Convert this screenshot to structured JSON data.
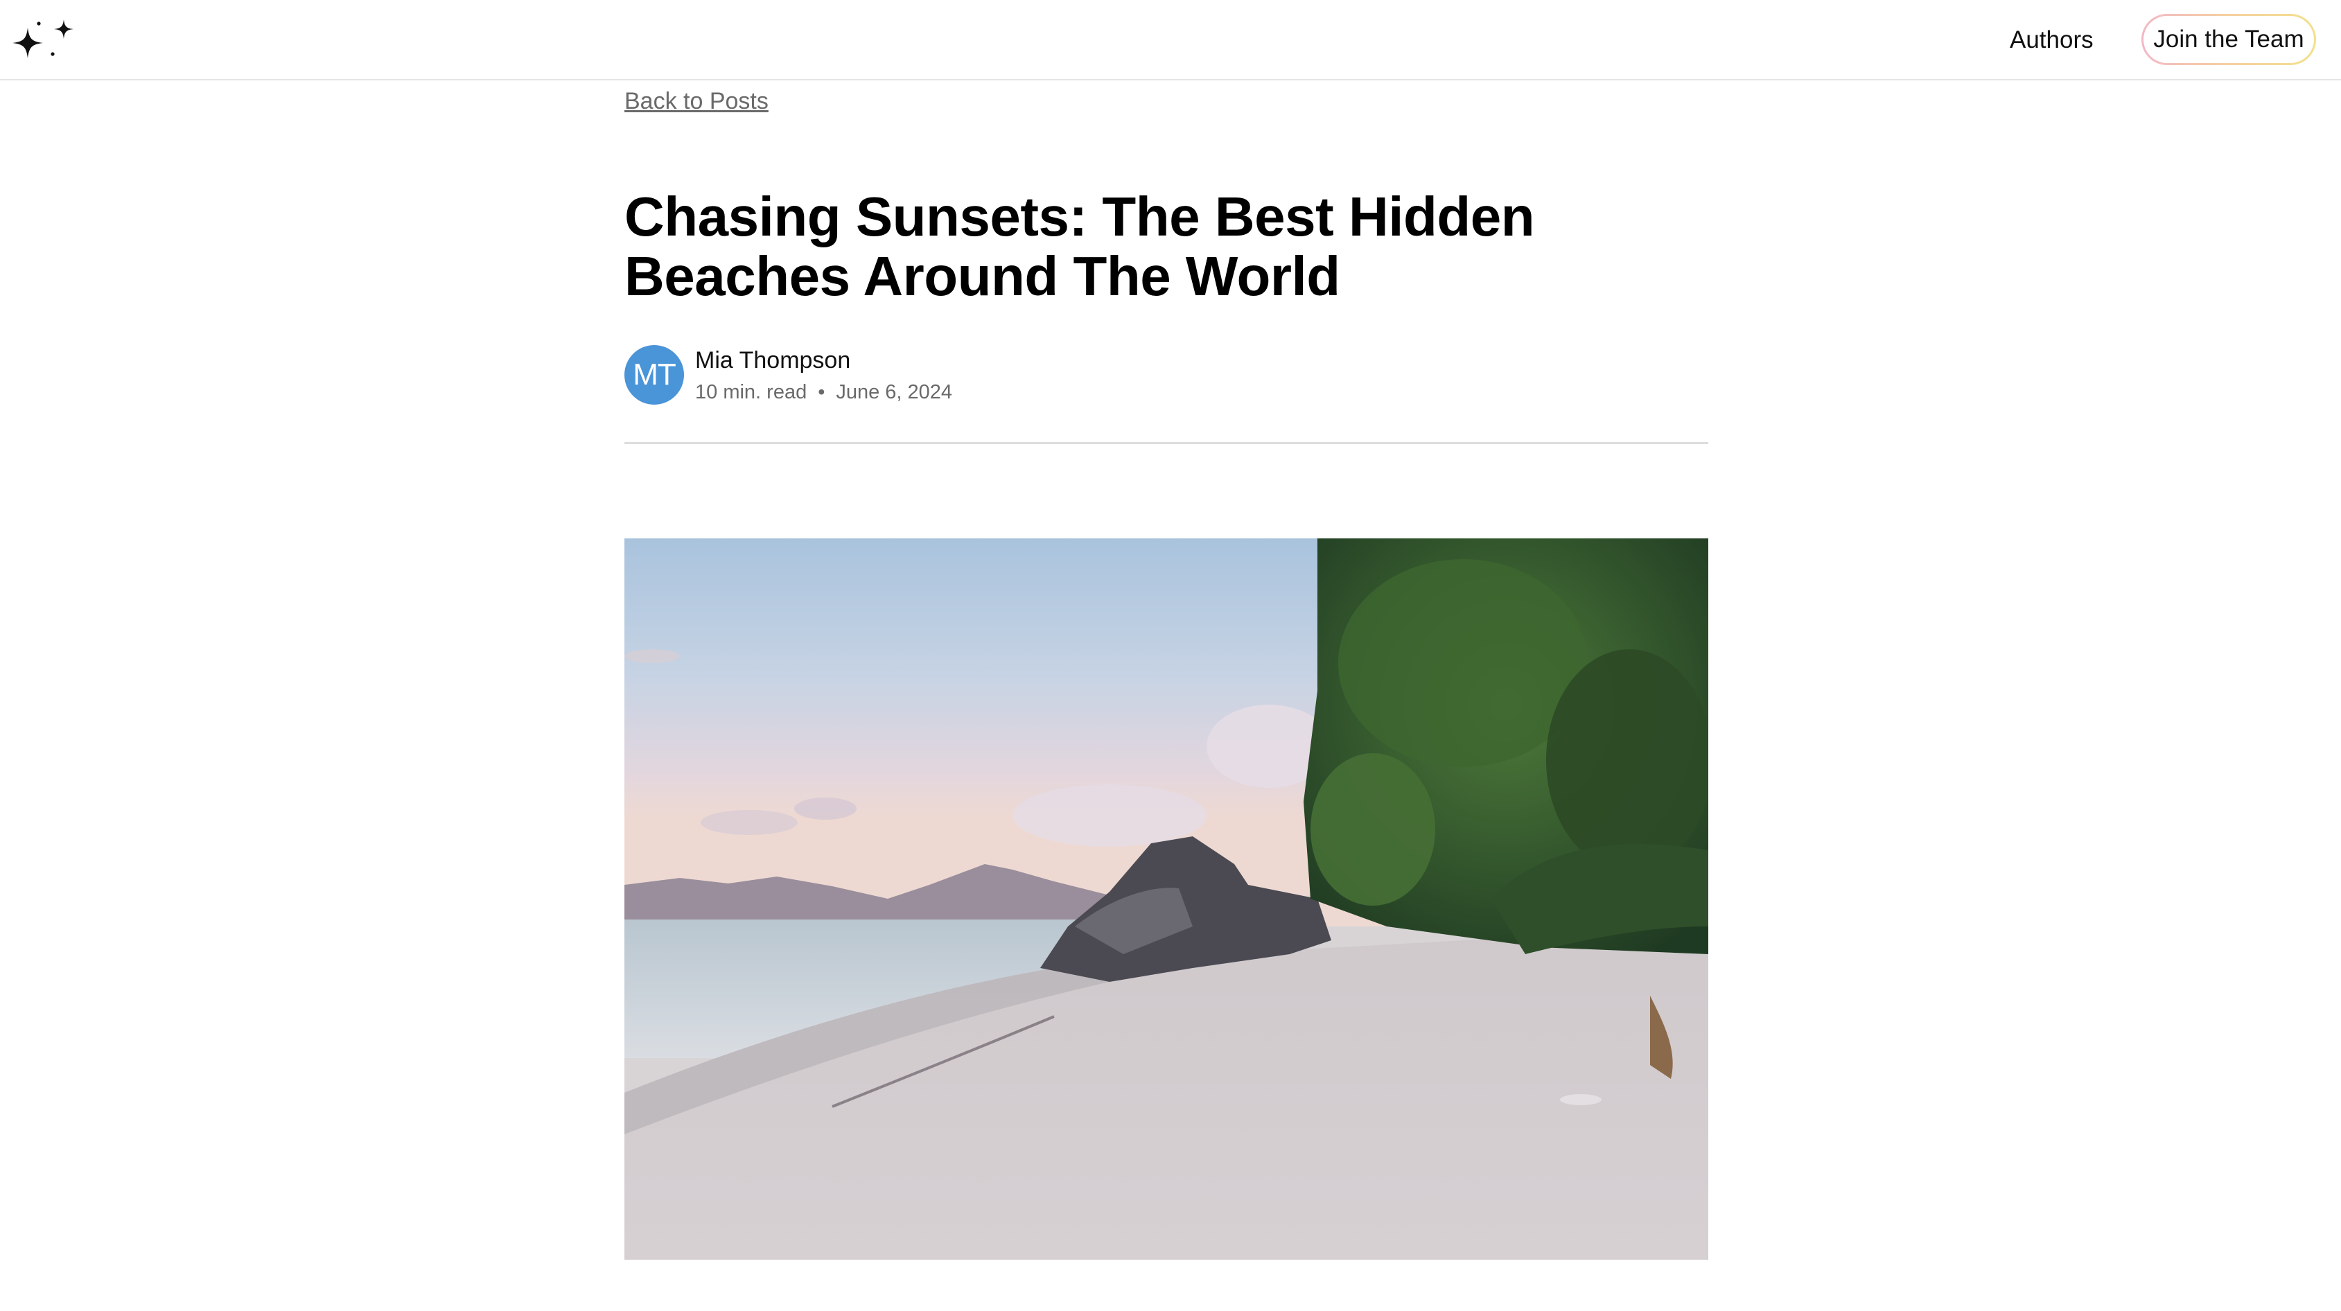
{
  "header": {
    "logo_icon": "sparkles-icon",
    "nav_authors": "Authors",
    "join_button": "Join the Team"
  },
  "post": {
    "back_link": "Back to Posts",
    "title": "Chasing Sunsets: The Best Hidden Beaches Around The World",
    "author": {
      "initials": "MT",
      "name": "Mia Thompson",
      "avatar_color": "#4a94d8"
    },
    "read_time": "10 min. read",
    "separator": "•",
    "date": "June 6, 2024"
  }
}
